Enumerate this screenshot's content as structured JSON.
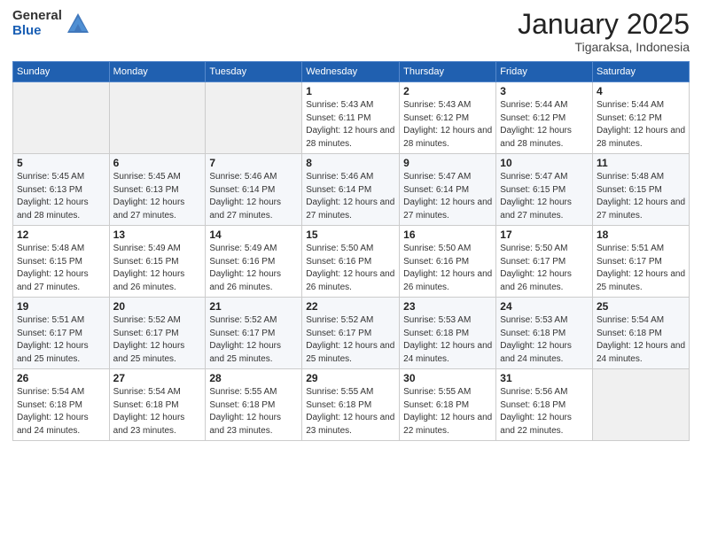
{
  "header": {
    "logo_general": "General",
    "logo_blue": "Blue",
    "month_title": "January 2025",
    "location": "Tigaraksa, Indonesia"
  },
  "weekdays": [
    "Sunday",
    "Monday",
    "Tuesday",
    "Wednesday",
    "Thursday",
    "Friday",
    "Saturday"
  ],
  "weeks": [
    [
      {
        "day": "",
        "sunrise": "",
        "sunset": "",
        "daylight": ""
      },
      {
        "day": "",
        "sunrise": "",
        "sunset": "",
        "daylight": ""
      },
      {
        "day": "",
        "sunrise": "",
        "sunset": "",
        "daylight": ""
      },
      {
        "day": "1",
        "sunrise": "Sunrise: 5:43 AM",
        "sunset": "Sunset: 6:11 PM",
        "daylight": "Daylight: 12 hours and 28 minutes."
      },
      {
        "day": "2",
        "sunrise": "Sunrise: 5:43 AM",
        "sunset": "Sunset: 6:12 PM",
        "daylight": "Daylight: 12 hours and 28 minutes."
      },
      {
        "day": "3",
        "sunrise": "Sunrise: 5:44 AM",
        "sunset": "Sunset: 6:12 PM",
        "daylight": "Daylight: 12 hours and 28 minutes."
      },
      {
        "day": "4",
        "sunrise": "Sunrise: 5:44 AM",
        "sunset": "Sunset: 6:12 PM",
        "daylight": "Daylight: 12 hours and 28 minutes."
      }
    ],
    [
      {
        "day": "5",
        "sunrise": "Sunrise: 5:45 AM",
        "sunset": "Sunset: 6:13 PM",
        "daylight": "Daylight: 12 hours and 28 minutes."
      },
      {
        "day": "6",
        "sunrise": "Sunrise: 5:45 AM",
        "sunset": "Sunset: 6:13 PM",
        "daylight": "Daylight: 12 hours and 27 minutes."
      },
      {
        "day": "7",
        "sunrise": "Sunrise: 5:46 AM",
        "sunset": "Sunset: 6:14 PM",
        "daylight": "Daylight: 12 hours and 27 minutes."
      },
      {
        "day": "8",
        "sunrise": "Sunrise: 5:46 AM",
        "sunset": "Sunset: 6:14 PM",
        "daylight": "Daylight: 12 hours and 27 minutes."
      },
      {
        "day": "9",
        "sunrise": "Sunrise: 5:47 AM",
        "sunset": "Sunset: 6:14 PM",
        "daylight": "Daylight: 12 hours and 27 minutes."
      },
      {
        "day": "10",
        "sunrise": "Sunrise: 5:47 AM",
        "sunset": "Sunset: 6:15 PM",
        "daylight": "Daylight: 12 hours and 27 minutes."
      },
      {
        "day": "11",
        "sunrise": "Sunrise: 5:48 AM",
        "sunset": "Sunset: 6:15 PM",
        "daylight": "Daylight: 12 hours and 27 minutes."
      }
    ],
    [
      {
        "day": "12",
        "sunrise": "Sunrise: 5:48 AM",
        "sunset": "Sunset: 6:15 PM",
        "daylight": "Daylight: 12 hours and 27 minutes."
      },
      {
        "day": "13",
        "sunrise": "Sunrise: 5:49 AM",
        "sunset": "Sunset: 6:15 PM",
        "daylight": "Daylight: 12 hours and 26 minutes."
      },
      {
        "day": "14",
        "sunrise": "Sunrise: 5:49 AM",
        "sunset": "Sunset: 6:16 PM",
        "daylight": "Daylight: 12 hours and 26 minutes."
      },
      {
        "day": "15",
        "sunrise": "Sunrise: 5:50 AM",
        "sunset": "Sunset: 6:16 PM",
        "daylight": "Daylight: 12 hours and 26 minutes."
      },
      {
        "day": "16",
        "sunrise": "Sunrise: 5:50 AM",
        "sunset": "Sunset: 6:16 PM",
        "daylight": "Daylight: 12 hours and 26 minutes."
      },
      {
        "day": "17",
        "sunrise": "Sunrise: 5:50 AM",
        "sunset": "Sunset: 6:17 PM",
        "daylight": "Daylight: 12 hours and 26 minutes."
      },
      {
        "day": "18",
        "sunrise": "Sunrise: 5:51 AM",
        "sunset": "Sunset: 6:17 PM",
        "daylight": "Daylight: 12 hours and 25 minutes."
      }
    ],
    [
      {
        "day": "19",
        "sunrise": "Sunrise: 5:51 AM",
        "sunset": "Sunset: 6:17 PM",
        "daylight": "Daylight: 12 hours and 25 minutes."
      },
      {
        "day": "20",
        "sunrise": "Sunrise: 5:52 AM",
        "sunset": "Sunset: 6:17 PM",
        "daylight": "Daylight: 12 hours and 25 minutes."
      },
      {
        "day": "21",
        "sunrise": "Sunrise: 5:52 AM",
        "sunset": "Sunset: 6:17 PM",
        "daylight": "Daylight: 12 hours and 25 minutes."
      },
      {
        "day": "22",
        "sunrise": "Sunrise: 5:52 AM",
        "sunset": "Sunset: 6:17 PM",
        "daylight": "Daylight: 12 hours and 25 minutes."
      },
      {
        "day": "23",
        "sunrise": "Sunrise: 5:53 AM",
        "sunset": "Sunset: 6:18 PM",
        "daylight": "Daylight: 12 hours and 24 minutes."
      },
      {
        "day": "24",
        "sunrise": "Sunrise: 5:53 AM",
        "sunset": "Sunset: 6:18 PM",
        "daylight": "Daylight: 12 hours and 24 minutes."
      },
      {
        "day": "25",
        "sunrise": "Sunrise: 5:54 AM",
        "sunset": "Sunset: 6:18 PM",
        "daylight": "Daylight: 12 hours and 24 minutes."
      }
    ],
    [
      {
        "day": "26",
        "sunrise": "Sunrise: 5:54 AM",
        "sunset": "Sunset: 6:18 PM",
        "daylight": "Daylight: 12 hours and 24 minutes."
      },
      {
        "day": "27",
        "sunrise": "Sunrise: 5:54 AM",
        "sunset": "Sunset: 6:18 PM",
        "daylight": "Daylight: 12 hours and 23 minutes."
      },
      {
        "day": "28",
        "sunrise": "Sunrise: 5:55 AM",
        "sunset": "Sunset: 6:18 PM",
        "daylight": "Daylight: 12 hours and 23 minutes."
      },
      {
        "day": "29",
        "sunrise": "Sunrise: 5:55 AM",
        "sunset": "Sunset: 6:18 PM",
        "daylight": "Daylight: 12 hours and 23 minutes."
      },
      {
        "day": "30",
        "sunrise": "Sunrise: 5:55 AM",
        "sunset": "Sunset: 6:18 PM",
        "daylight": "Daylight: 12 hours and 22 minutes."
      },
      {
        "day": "31",
        "sunrise": "Sunrise: 5:56 AM",
        "sunset": "Sunset: 6:18 PM",
        "daylight": "Daylight: 12 hours and 22 minutes."
      },
      {
        "day": "",
        "sunrise": "",
        "sunset": "",
        "daylight": ""
      }
    ]
  ]
}
